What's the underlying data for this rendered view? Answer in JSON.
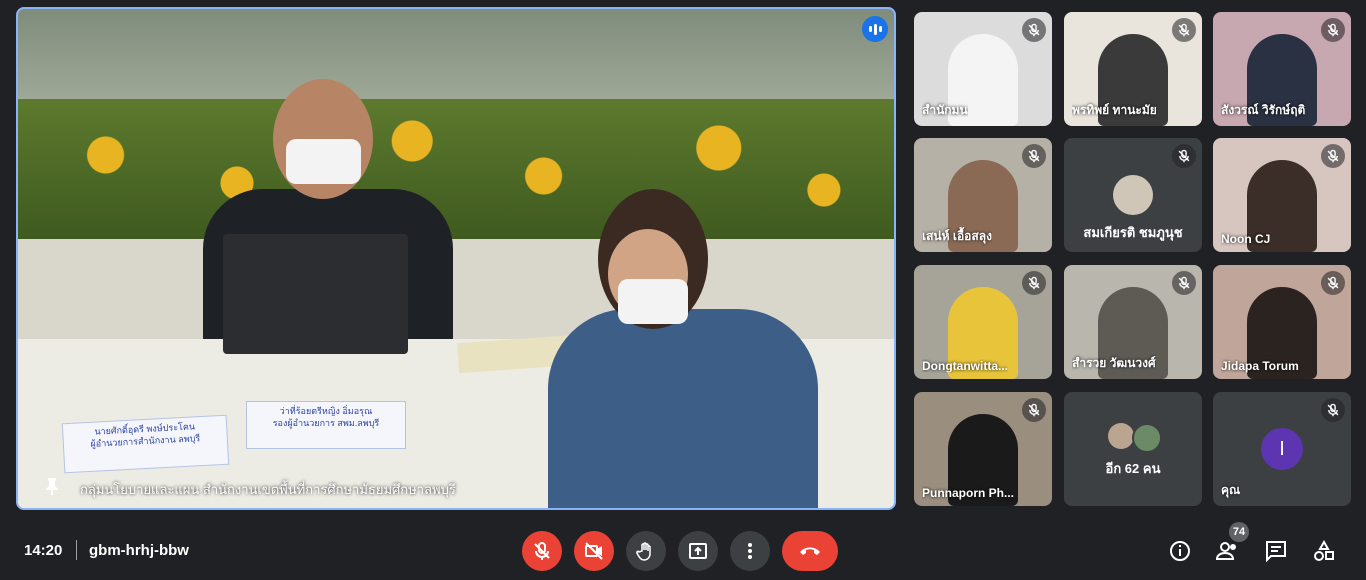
{
  "main": {
    "caption": "กลุ่มนโยบายและแผน สำนักงานเขตพื้นที่การศึกษามัธยมศึกษาลพบุรี",
    "nameplate_left_line1": "นายศักดิ์อุดรี พงษ์ประโคน",
    "nameplate_left_line2": "ผู้อำนวยการสำนักงาน ลพบุรี",
    "nameplate_right_line1": "ว่าที่ร้อยตรีหญิง อิ่มอรุณ",
    "nameplate_right_line2": "รองผู้อำนวยการ สพม.ลพบุรี"
  },
  "tiles": [
    {
      "name": "สำนักมน",
      "muted": true
    },
    {
      "name": "พรทิพย์ ทานะมัย",
      "muted": true
    },
    {
      "name": "สังวรณ์ วิรักษ์ฤติ",
      "muted": true
    },
    {
      "name": "เสน่ห์ เอื้อสลุง",
      "muted": true
    },
    {
      "name": "สมเกียรติ ชมภูนุช",
      "muted": true
    },
    {
      "name": "Noon CJ",
      "muted": true
    },
    {
      "name": "Dongtanwitta...",
      "muted": true
    },
    {
      "name": "สำรวย วัฒนวงศ์",
      "muted": true
    },
    {
      "name": "Jidapa Torum",
      "muted": true
    },
    {
      "name": "Punnaporn Ph...",
      "muted": true
    },
    {
      "name": "อีก 62 คน",
      "muted": false
    },
    {
      "name": "คุณ",
      "muted": true,
      "avatar_letter": "I"
    }
  ],
  "bar": {
    "time": "14:20",
    "meeting_code": "gbm-hrhj-bbw",
    "participants_count": "74"
  },
  "colors": {
    "accent": "#8ab4f8",
    "danger": "#ea4335",
    "background": "#202124",
    "avatar_purple": "#5e35b1"
  }
}
